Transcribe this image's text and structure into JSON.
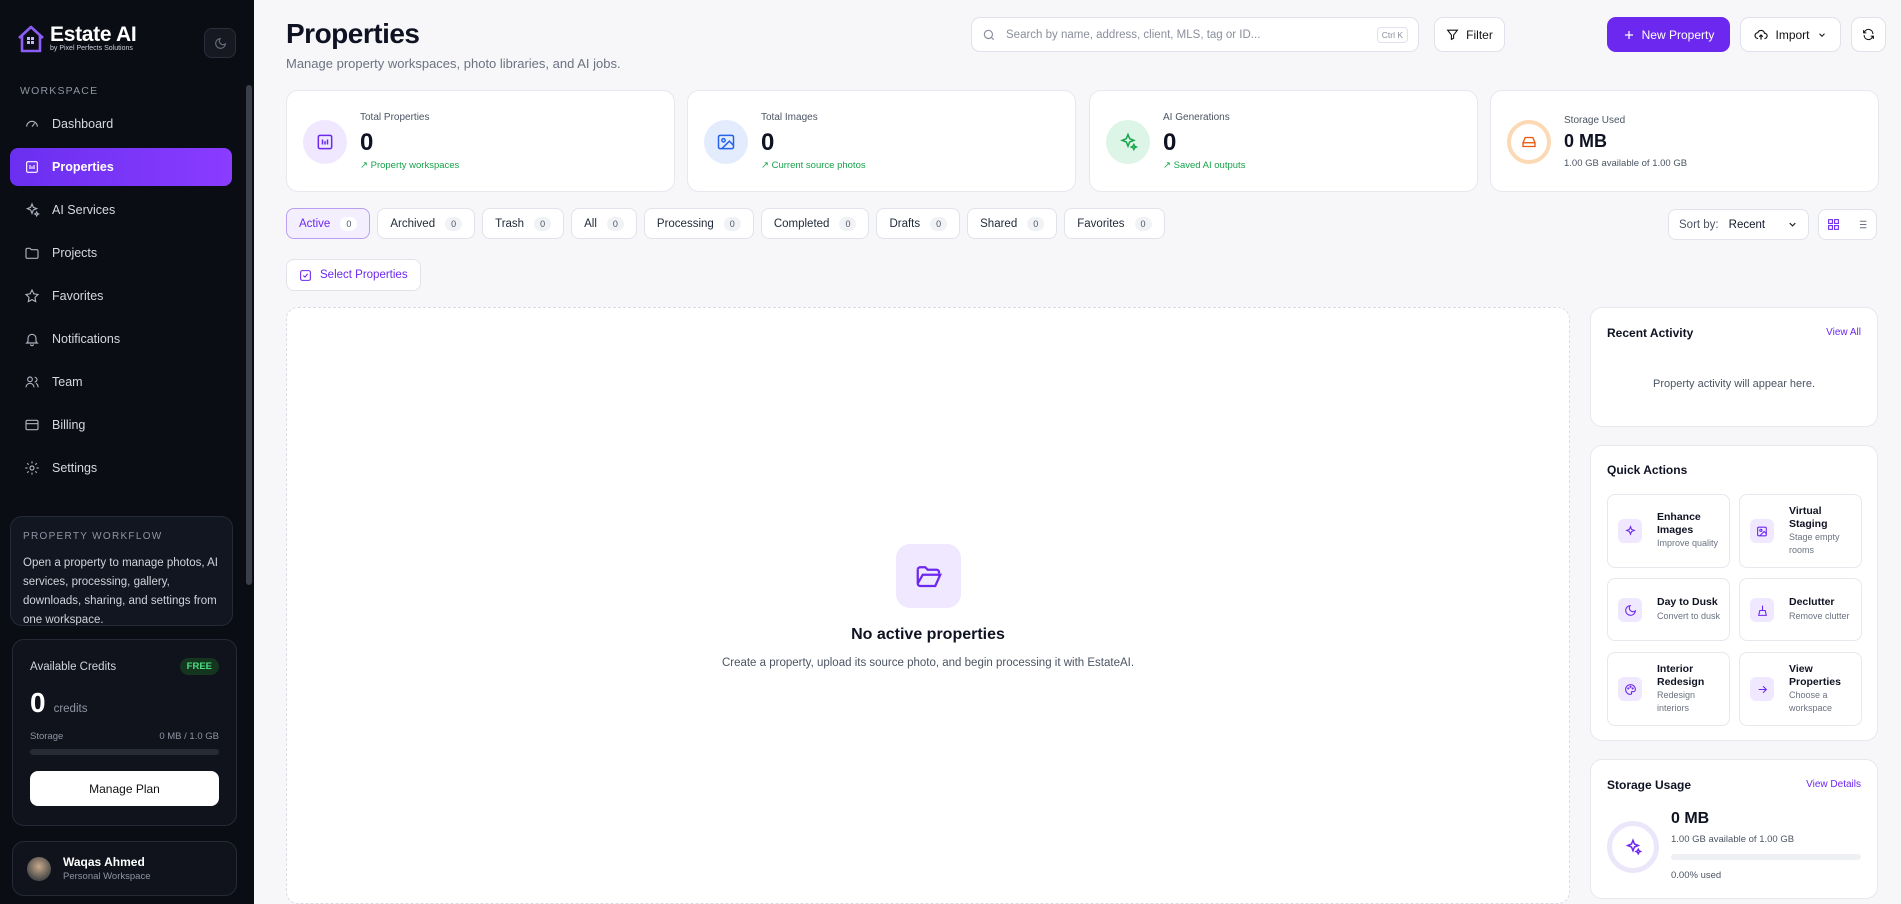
{
  "sidebar": {
    "logo": {
      "title": "Estate AI",
      "subtitle": "by Pixel Perfects Solutions"
    },
    "section_label": "WORKSPACE",
    "items": [
      {
        "label": "Dashboard",
        "icon": "gauge-icon"
      },
      {
        "label": "Properties",
        "icon": "building-icon",
        "active": true
      },
      {
        "label": "AI Services",
        "icon": "sparkles-icon"
      },
      {
        "label": "Projects",
        "icon": "folder-icon"
      },
      {
        "label": "Favorites",
        "icon": "star-icon"
      },
      {
        "label": "Notifications",
        "icon": "bell-icon"
      },
      {
        "label": "Team",
        "icon": "users-icon"
      },
      {
        "label": "Billing",
        "icon": "credit-card-icon"
      },
      {
        "label": "Settings",
        "icon": "gear-icon"
      }
    ],
    "workflow": {
      "title": "PROPERTY WORKFLOW",
      "text": "Open a property to manage photos, AI services, processing, gallery, downloads, sharing, and settings from one workspace."
    },
    "credits": {
      "label": "Available Credits",
      "badge": "FREE",
      "value": "0",
      "unit": "credits",
      "storage_label": "Storage",
      "storage_value": "0 MB / 1.0 GB",
      "storage_fraction": 0,
      "button": "Manage Plan"
    },
    "user": {
      "name": "Waqas Ahmed",
      "workspace": "Personal Workspace"
    }
  },
  "header": {
    "title": "Properties",
    "subtitle": "Manage property workspaces, photo libraries, and AI jobs.",
    "search_placeholder": "Search by name, address, client, MLS, tag or ID...",
    "search_shortcut": "Ctrl K",
    "filter_label": "Filter",
    "new_label": "New Property",
    "import_label": "Import"
  },
  "stats": [
    {
      "label": "Total Properties",
      "value": "0",
      "note": "Property workspaces",
      "icon": "building-icon"
    },
    {
      "label": "Total Images",
      "value": "0",
      "note": "Current source photos",
      "icon": "image-icon"
    },
    {
      "label": "AI Generations",
      "value": "0",
      "note": "Saved AI outputs",
      "icon": "sparkles-icon"
    },
    {
      "label": "Storage Used",
      "value": "0 MB",
      "note": "1.00 GB available of 1.00 GB",
      "icon": "hard-drive-icon"
    }
  ],
  "tabs": [
    {
      "label": "Active",
      "count": "0",
      "active": true
    },
    {
      "label": "Archived",
      "count": "0"
    },
    {
      "label": "Trash",
      "count": "0"
    },
    {
      "label": "All",
      "count": "0"
    },
    {
      "label": "Processing",
      "count": "0"
    },
    {
      "label": "Completed",
      "count": "0"
    },
    {
      "label": "Drafts",
      "count": "0"
    },
    {
      "label": "Shared",
      "count": "0"
    },
    {
      "label": "Favorites",
      "count": "0"
    }
  ],
  "sort": {
    "label": "Sort by:",
    "value": "Recent"
  },
  "select_label": "Select Properties",
  "empty": {
    "title": "No active properties",
    "subtitle": "Create a property, upload its source photo, and begin processing it with EstateAI."
  },
  "recent_activity": {
    "title": "Recent Activity",
    "link": "View All",
    "empty": "Property activity will appear here."
  },
  "quick_actions": {
    "title": "Quick Actions",
    "items": [
      {
        "title": "Enhance Images",
        "sub": "Improve quality",
        "icon": "sparkles-icon"
      },
      {
        "title": "Virtual Staging",
        "sub": "Stage empty rooms",
        "icon": "image-plus-icon"
      },
      {
        "title": "Day to Dusk",
        "sub": "Convert to dusk",
        "icon": "moon-icon"
      },
      {
        "title": "Declutter",
        "sub": "Remove clutter",
        "icon": "broom-icon"
      },
      {
        "title": "Interior Redesign",
        "sub": "Redesign interiors",
        "icon": "palette-icon"
      },
      {
        "title": "View Properties",
        "sub": "Choose a workspace",
        "icon": "arrow-right-icon"
      }
    ]
  },
  "storage_usage": {
    "title": "Storage Usage",
    "link": "View Details",
    "value": "0 MB",
    "available": "1.00 GB available of 1.00 GB",
    "used": "0.00% used",
    "fraction": 0
  },
  "colors": {
    "accent": "#6d28f0",
    "sidebar_bg": "#0b0d14",
    "success": "#16a34a"
  }
}
